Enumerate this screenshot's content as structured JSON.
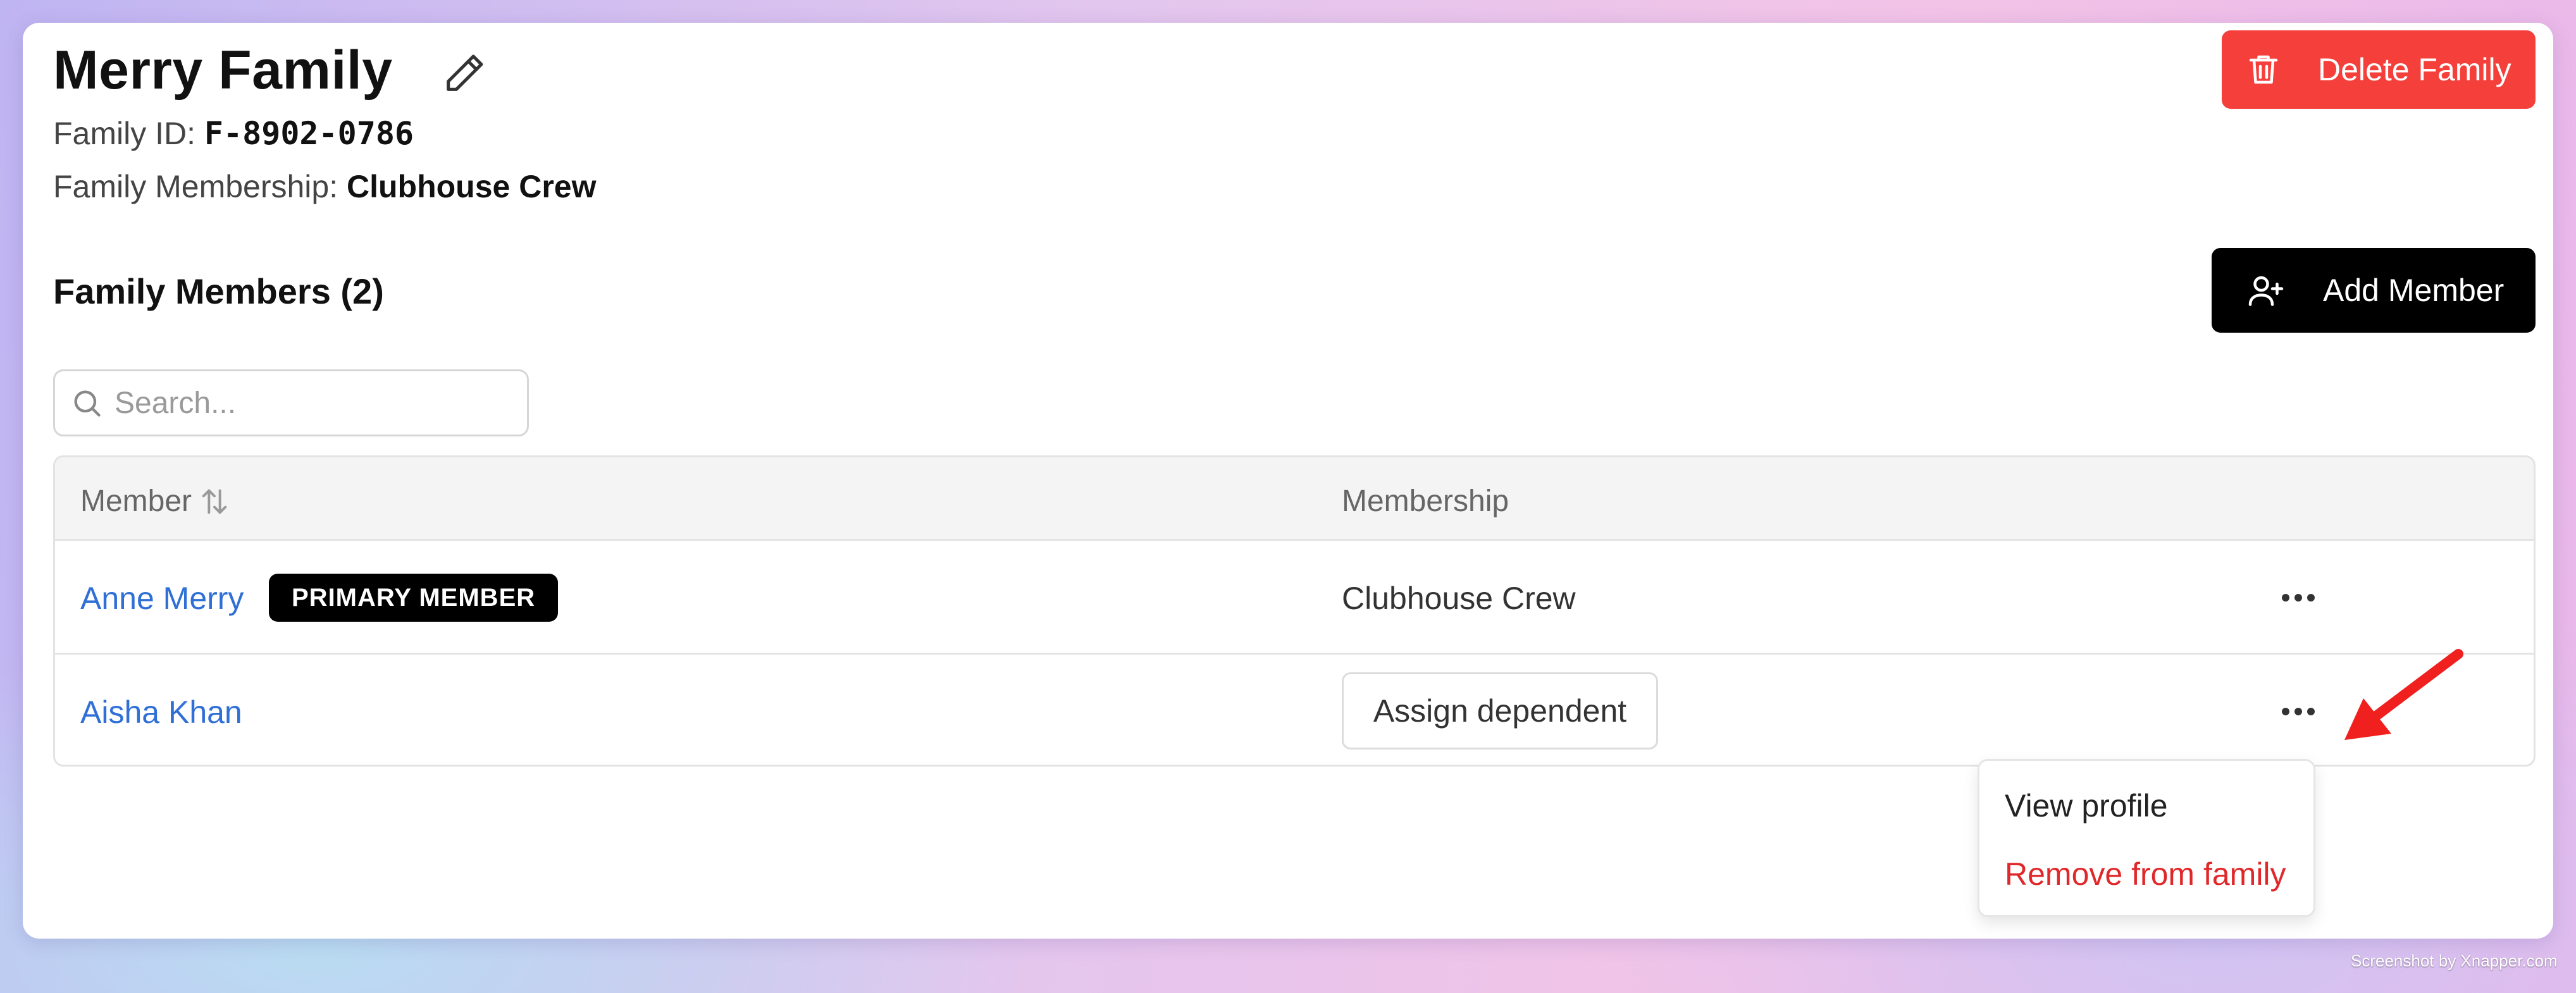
{
  "header": {
    "title": "Merry Family",
    "family_id_label": "Family ID: ",
    "family_id_value": "F-8902-0786",
    "membership_label": "Family Membership: ",
    "membership_value": "Clubhouse Crew",
    "delete_label": "Delete Family"
  },
  "members_section": {
    "title": "Family Members (2)",
    "add_label": "Add Member",
    "search_placeholder": "Search..."
  },
  "table": {
    "columns": [
      "Member",
      "Membership"
    ],
    "rows": [
      {
        "name": "Anne Merry",
        "badge": "PRIMARY MEMBER",
        "membership": "Clubhouse Crew"
      },
      {
        "name": "Aisha Khan",
        "action": "Assign dependent"
      }
    ]
  },
  "context_menu": {
    "items": [
      {
        "label": "View profile"
      },
      {
        "label": "Remove from family"
      }
    ]
  },
  "colors": {
    "danger": "#f53f3b",
    "link": "#2f6fd6",
    "remove_text": "#e0282a",
    "annotation_arrow": "#f0201e"
  },
  "footer": {
    "credit": "Screenshot by Xnapper.com"
  }
}
